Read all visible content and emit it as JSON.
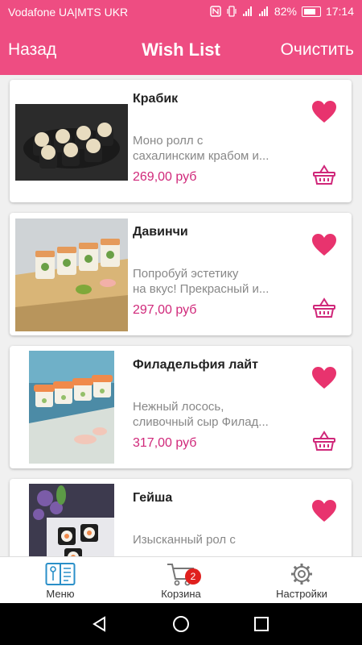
{
  "status_bar": {
    "carrier": "Vodafone UA|MTS UKR",
    "battery": "82%",
    "time": "17:14"
  },
  "header": {
    "back_label": "Назад",
    "title": "Wish List",
    "clear_label": "Очистить"
  },
  "products": [
    {
      "name": "Крабик",
      "desc_line1": "Моно ролл с",
      "desc_line2": "сахалинским крабом и...",
      "price": "269,00 руб"
    },
    {
      "name": "Давинчи",
      "desc_line1": "Попробуй эстетику",
      "desc_line2": "на вкус! Прекрасный и...",
      "price": "297,00 руб"
    },
    {
      "name": "Филадельфия лайт",
      "desc_line1": "Нежный лосось,",
      "desc_line2": "сливочный сыр Филад...",
      "price": "317,00 руб"
    },
    {
      "name": "Гейша",
      "desc_line1": "Изысканный рол с",
      "desc_line2": "",
      "price": ""
    }
  ],
  "bottom_nav": {
    "menu_label": "Меню",
    "cart_label": "Корзина",
    "cart_badge": "2",
    "settings_label": "Настройки"
  },
  "colors": {
    "accent": "#ee4d82",
    "price": "#d0287a",
    "heart": "#e8336e",
    "active_nav": "#2a8fc8"
  }
}
